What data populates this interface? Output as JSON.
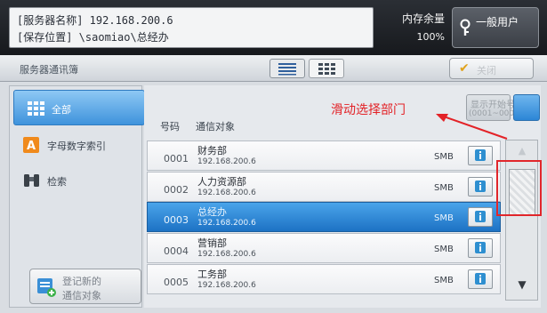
{
  "header": {
    "server_name_line": "[服务器名称]  192.168.200.6",
    "save_location_line": "[保存位置]  \\saomiao\\总经办",
    "memory_label": "内存余量",
    "memory_value": "100%",
    "user_button_label": "一般用户"
  },
  "titlebar": {
    "title": "服务器通讯簿",
    "close_label": "关闭"
  },
  "nav": {
    "items": [
      {
        "label": "全部",
        "selected": true
      },
      {
        "label": "字母数字索引",
        "selected": false
      },
      {
        "label": "检索",
        "selected": false
      }
    ],
    "register_line1": "登记新的",
    "register_line2": "通信对象"
  },
  "list": {
    "col_number": "号码",
    "col_target": "通信对象",
    "start_label_line1": "显示开始号码",
    "start_label_line2": "(0001~0000)",
    "rows": [
      {
        "number": "0001",
        "name": "财务部",
        "address": "192.168.200.6",
        "protocol": "SMB",
        "selected": false
      },
      {
        "number": "0002",
        "name": "人力资源部",
        "address": "192.168.200.6",
        "protocol": "SMB",
        "selected": false
      },
      {
        "number": "0003",
        "name": "总经办",
        "address": "192.168.200.6",
        "protocol": "SMB",
        "selected": true
      },
      {
        "number": "0004",
        "name": "营销部",
        "address": "192.168.200.6",
        "protocol": "SMB",
        "selected": false
      },
      {
        "number": "0005",
        "name": "工务部",
        "address": "192.168.200.6",
        "protocol": "SMB",
        "selected": false
      }
    ]
  },
  "scroll": {
    "up": "▲",
    "down": "▼"
  },
  "annotation": {
    "text": "滑动选择部门",
    "color": "#e32227"
  }
}
